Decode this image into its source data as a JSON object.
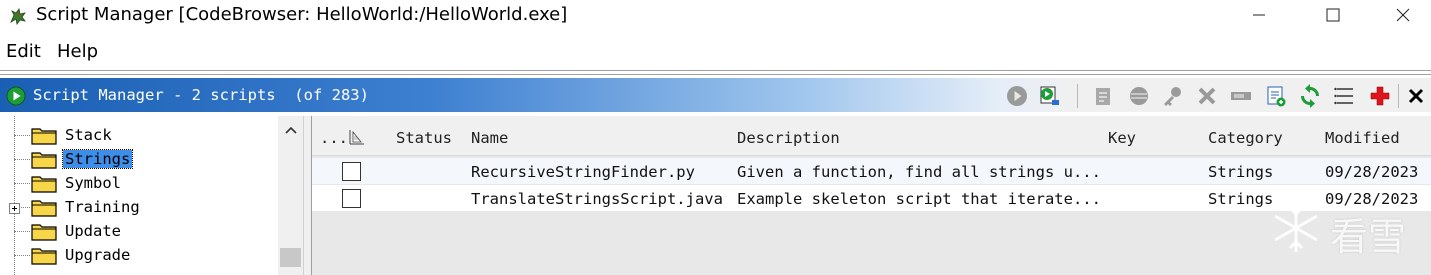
{
  "window": {
    "title": "Script Manager [CodeBrowser: HelloWorld:/HelloWorld.exe]",
    "app_icon": "ghidra-dragon-icon",
    "controls": {
      "minimize": "minimize-icon",
      "maximize": "maximize-icon",
      "close": "close-icon"
    }
  },
  "menu": {
    "edit": "Edit",
    "help": "Help"
  },
  "component": {
    "title": "Script Manager - 2 scripts  (of 283)",
    "icon": "run-play-icon",
    "toolbar_icons": [
      "run-script-icon",
      "run-last-script-icon",
      "edit-script-icon",
      "eclipse-edit-icon",
      "key-binding-icon",
      "delete-script-icon",
      "rename-script-icon",
      "new-script-icon",
      "refresh-icon",
      "script-directories-icon",
      "help-icon",
      "close-panel-icon"
    ],
    "accent": "#1a5fb4"
  },
  "tree": {
    "items": [
      {
        "label": "Stack",
        "selected": false,
        "expandable": false
      },
      {
        "label": "Strings",
        "selected": true,
        "expandable": false
      },
      {
        "label": "Symbol",
        "selected": false,
        "expandable": false
      },
      {
        "label": "Training",
        "selected": false,
        "expandable": true
      },
      {
        "label": "Update",
        "selected": false,
        "expandable": false
      },
      {
        "label": "Upgrade",
        "selected": false,
        "expandable": false
      }
    ]
  },
  "table": {
    "columns": {
      "ellipsis": "...",
      "status": "Status",
      "name": "Name",
      "description": "Description",
      "key": "Key",
      "category": "Category",
      "modified": "Modified"
    },
    "rows": [
      {
        "checked": false,
        "status": "",
        "name": "RecursiveStringFinder.py",
        "description": "Given a function, find all strings u...",
        "key": "",
        "category": "Strings",
        "modified": "09/28/2023"
      },
      {
        "checked": false,
        "status": "",
        "name": "TranslateStringsScript.java",
        "description": "Example skeleton script that iterate...",
        "key": "",
        "category": "Strings",
        "modified": "09/28/2023"
      }
    ]
  },
  "watermark": {
    "text": "看雪",
    "icon": "snowflake-icon"
  }
}
